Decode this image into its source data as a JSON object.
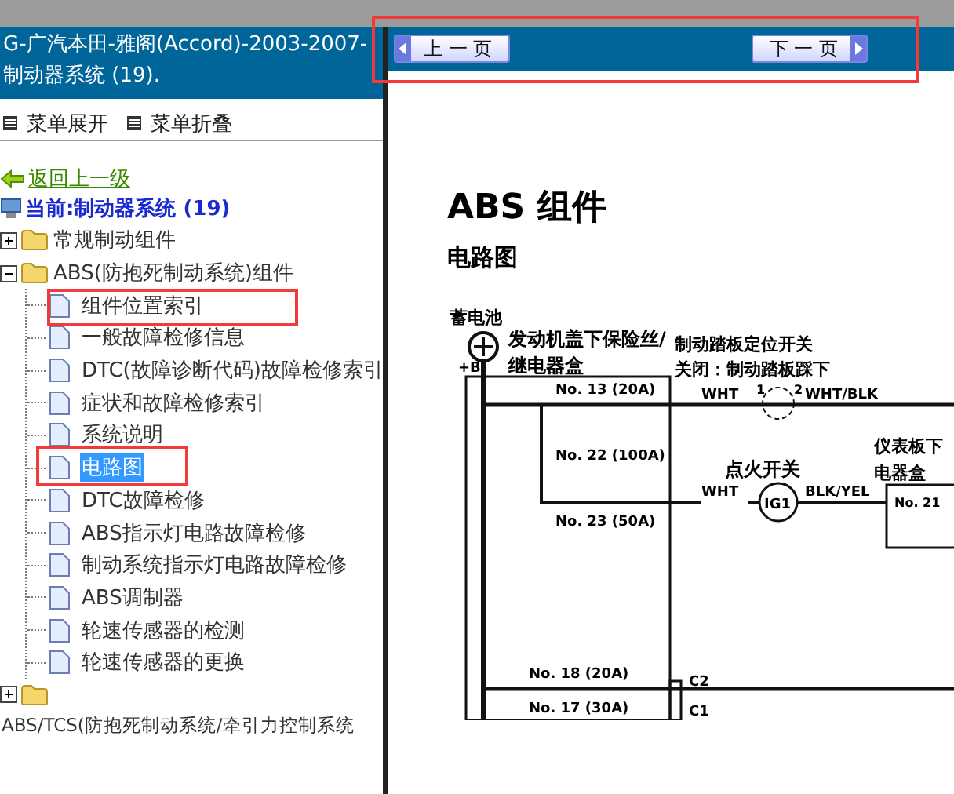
{
  "sidebar": {
    "title": "G-广汽本田-雅阁(Accord)-2003-2007- 制动器系统 (19).",
    "menu_links": [
      "菜单展开",
      "菜单折叠"
    ],
    "back_link": "返回上一级",
    "current": "当前:制动器系统 (19)",
    "tree": [
      {
        "label": "常规制动组件",
        "kind": "folder",
        "expanded": false,
        "selected": false
      },
      {
        "label": "ABS(防抱死制动系统)组件",
        "kind": "folder",
        "expanded": true,
        "selected": false,
        "children": [
          {
            "label": "组件位置索引",
            "kind": "page",
            "selected": false
          },
          {
            "label": "一般故障检修信息",
            "kind": "page",
            "selected": false
          },
          {
            "label": "DTC(故障诊断代码)故障检修索引",
            "kind": "page",
            "selected": false
          },
          {
            "label": "症状和故障检修索引",
            "kind": "page",
            "selected": false
          },
          {
            "label": "系统说明",
            "kind": "page",
            "selected": false
          },
          {
            "label": "电路图",
            "kind": "page",
            "selected": true
          },
          {
            "label": "DTC故障检修",
            "kind": "page",
            "selected": false
          },
          {
            "label": "ABS指示灯电路故障检修",
            "kind": "page",
            "selected": false
          },
          {
            "label": "制动系统指示灯电路故障检修",
            "kind": "page",
            "selected": false
          },
          {
            "label": "ABS调制器",
            "kind": "page",
            "selected": false
          },
          {
            "label": "轮速传感器的检测",
            "kind": "page",
            "selected": false
          },
          {
            "label": "轮速传感器的更换",
            "kind": "page",
            "selected": false
          }
        ]
      },
      {
        "label": "ABS/TCS(防抱死制动系统/牵引力控制系统",
        "kind": "folder",
        "expanded": false,
        "selected": false
      }
    ]
  },
  "nav": {
    "prev": "上 一 页",
    "next": "下 一 页"
  },
  "document": {
    "heading": "ABS 组件",
    "subheading": "电路图",
    "diagram_labels": [
      "蓄电池",
      "+B",
      "发动机盖下保险丝/",
      "继电器盒",
      "No. 13 (20A)",
      "No. 22 (100A)",
      "No. 23 (50A)",
      "制动踏板定位开关",
      "关闭：制动踏板踩下",
      "1",
      "2",
      "WHT",
      "WHT/BLK",
      "点火开关",
      "WHT",
      "IG1",
      "BLK/YEL",
      "仪表板下",
      "电器盒",
      "No. 21",
      "No. 18 (20A)",
      "No. 17 (30A)",
      "C2",
      "C1"
    ]
  }
}
